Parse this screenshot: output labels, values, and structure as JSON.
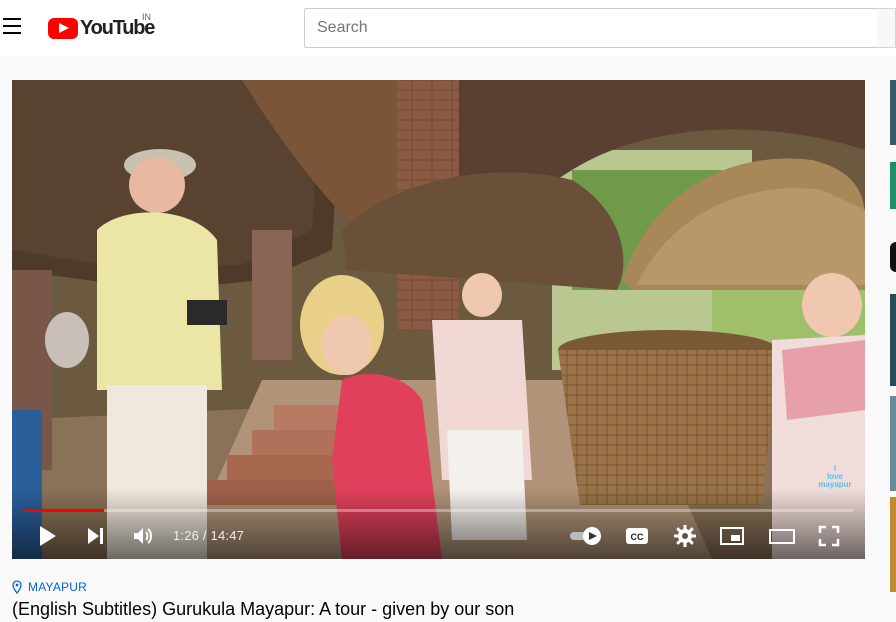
{
  "header": {
    "logo_text": "YouTube",
    "country_code": "IN",
    "search_placeholder": "Search"
  },
  "player": {
    "current_time": "1:26",
    "duration": "14:47",
    "time_display": "1:26 / 14:47",
    "progress_fraction": 0.097,
    "watermark": [
      "I",
      "love",
      "mayapur"
    ],
    "icons": [
      "play-icon",
      "next-icon",
      "volume-icon",
      "autoplay-toggle-icon",
      "captions-icon",
      "settings-icon",
      "miniplayer-icon",
      "theater-mode-icon",
      "fullscreen-icon"
    ]
  },
  "video": {
    "location": "MAYAPUR",
    "title": "(English Subtitles) Gurukula Mayapur: A tour - given by our son"
  },
  "colors": {
    "brand_red": "#ff0000",
    "link_blue": "#065fd4"
  }
}
